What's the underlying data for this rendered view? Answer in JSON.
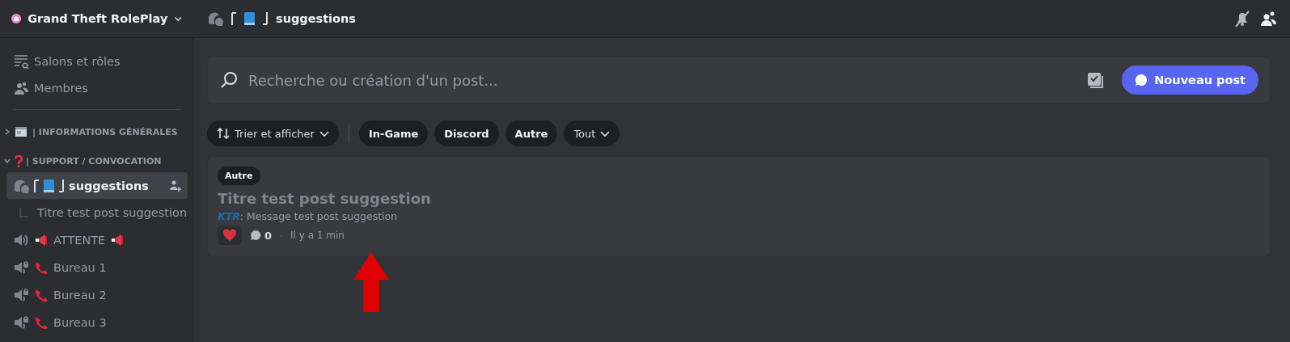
{
  "server": {
    "name": "Grand Theft RolePlay"
  },
  "sidebar": {
    "links": [
      {
        "kind": "channels",
        "label": "Salons et rôles"
      },
      {
        "kind": "members",
        "label": "Membres"
      }
    ],
    "categories": [
      {
        "name": "| INFORMATIONS GÉNÉRALES",
        "emojis": [
          {
            "kind": "newspaper"
          }
        ],
        "expanded": false
      },
      {
        "name": "| SUPPORT / CONVOCATION",
        "emojis": [
          {
            "kind": "question"
          }
        ],
        "expanded": true,
        "channels": [
          {
            "kind": "forum",
            "emojis": [
              {
                "kind": "bracket-open"
              },
              {
                "kind": "book"
              },
              {
                "kind": "bracket-close"
              }
            ],
            "name": "suggestions",
            "selected": true,
            "children": [
              {
                "name": "Titre test post suggestion"
              }
            ]
          },
          {
            "kind": "voice",
            "emojis": [
              {
                "kind": "megaphone"
              }
            ],
            "name": "ATTENTE",
            "emojis_after": [
              {
                "kind": "megaphone"
              }
            ],
            "selected": false
          },
          {
            "kind": "voice-locked",
            "emojis": [
              {
                "kind": "phone"
              }
            ],
            "name": "Bureau 1",
            "selected": false
          },
          {
            "kind": "voice-locked",
            "emojis": [
              {
                "kind": "phone"
              }
            ],
            "name": "Bureau 2",
            "selected": false
          },
          {
            "kind": "voice-locked",
            "emojis": [
              {
                "kind": "phone"
              }
            ],
            "name": "Bureau 3",
            "selected": false
          }
        ]
      }
    ]
  },
  "topbar": {
    "emojis": [
      {
        "kind": "bracket-open"
      },
      {
        "kind": "book"
      },
      {
        "kind": "bracket-close"
      }
    ],
    "channel": "suggestions"
  },
  "forum": {
    "search": {
      "placeholder": "Recherche ou création d'un post..."
    },
    "new_post": "Nouveau post",
    "sort": "Trier et afficher",
    "tags": [
      {
        "label": "In-Game"
      },
      {
        "label": "Discord"
      },
      {
        "label": "Autre"
      }
    ],
    "all_tags": "Tout",
    "posts": [
      {
        "tag": "Autre",
        "title": "Titre test post suggestion",
        "author": "KTR",
        "message": ": Message test post suggestion",
        "comments": "0",
        "time": "Il y a 1 min"
      }
    ]
  }
}
